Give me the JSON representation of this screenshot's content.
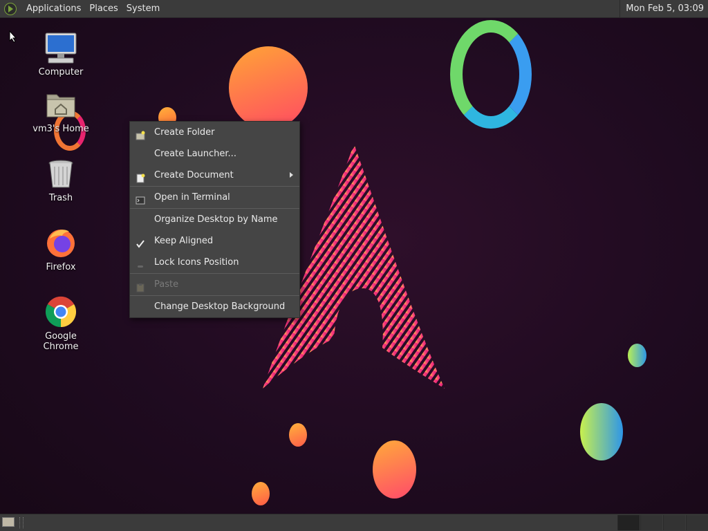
{
  "top_panel": {
    "menus": [
      "Applications",
      "Places",
      "System"
    ],
    "clock": "Mon Feb  5, 03:09"
  },
  "desktop_icons": [
    {
      "label": "Computer",
      "icon": "computer-icon"
    },
    {
      "label": "vm3's Home",
      "icon": "home-folder-icon"
    },
    {
      "label": "Trash",
      "icon": "trash-icon"
    },
    {
      "label": "Firefox",
      "icon": "firefox-icon"
    },
    {
      "label": "Google Chrome",
      "icon": "chrome-icon"
    }
  ],
  "context_menu": {
    "items": [
      {
        "label": "Create Folder",
        "icon": "new-folder-icon"
      },
      {
        "label": "Create Launcher...",
        "icon": ""
      },
      {
        "label": "Create Document",
        "icon": "new-document-icon",
        "submenu": true
      },
      {
        "label": "Open in Terminal",
        "icon": "terminal-icon"
      },
      {
        "label": "Organize Desktop by Name",
        "icon": ""
      },
      {
        "label": "Keep Aligned",
        "icon": "checkmark-icon",
        "checked": true
      },
      {
        "label": "Lock Icons Position",
        "icon": "lock-toggle-icon"
      },
      {
        "label": "Paste",
        "icon": "paste-icon",
        "disabled": true
      },
      {
        "label": "Change Desktop Background",
        "icon": ""
      }
    ]
  },
  "colors": {
    "panel": "#3b3b3b",
    "menu_bg": "#454545",
    "wallpaper": "#1f0b20",
    "accent_pink": "#e8246e"
  }
}
